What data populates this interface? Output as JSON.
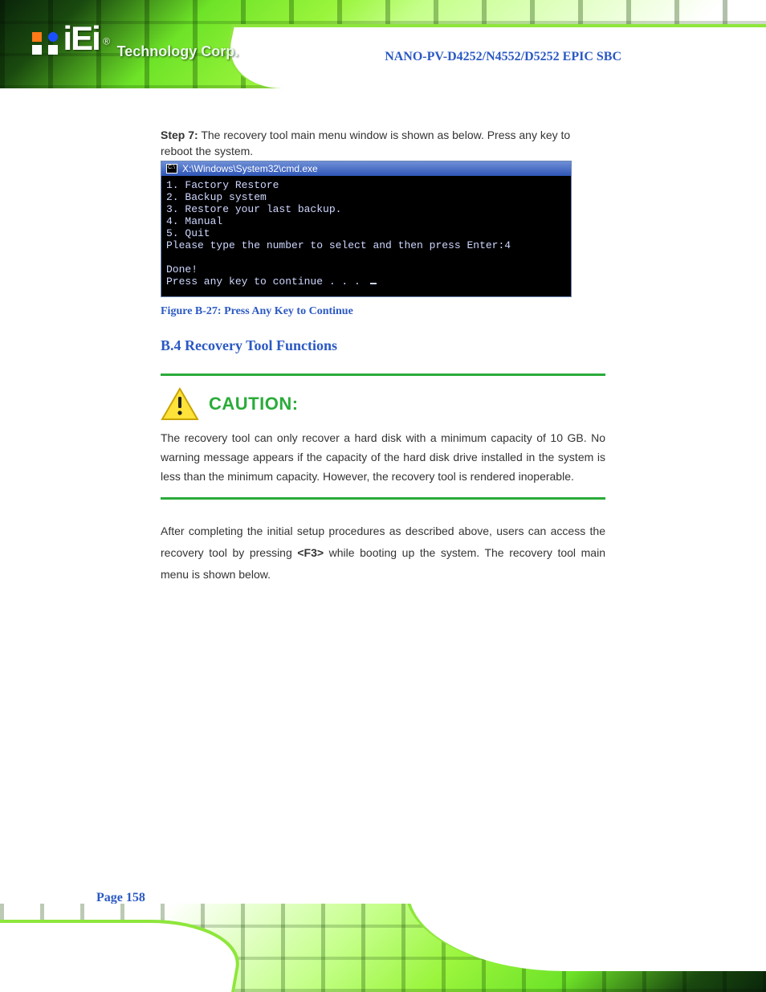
{
  "brand": {
    "logo_text": "iEi",
    "registered": "®",
    "tagline": "Technology Corp."
  },
  "document_title": "NANO-PV-D4252/N4552/D5252 EPIC SBC",
  "step7": {
    "label": "Step 7:",
    "text_a": "The recovery tool main menu window is shown as below. Press any key to",
    "text_b": "reboot the system.",
    "press_any": "Press any key to",
    "reboot": "reboot the system."
  },
  "cmd": {
    "title": "X:\\Windows\\System32\\cmd.exe",
    "lines": [
      "1. Factory Restore",
      "2. Backup system",
      "3. Restore your last backup.",
      "4. Manual",
      "5. Quit",
      "Please type the number to select and then press Enter:4",
      "",
      "Done!",
      "Press any key to continue . . . "
    ]
  },
  "figure_caption": "Figure B-27: Press Any Key to Continue",
  "section_heading": "B.4 Recovery Tool Functions",
  "caution": {
    "label": "CAUTION:",
    "text": "The recovery tool can only recover a hard disk with a minimum capacity of 10 GB. No warning message appears if the capacity of the hard disk drive installed in the system is less than the minimum capacity. However, the recovery tool is rendered inoperable."
  },
  "body_paragraph": {
    "before_code": "After completing the initial setup procedures as described above, users can access the recovery tool by pressing ",
    "key_combo": "<F3>",
    "after_code": " while booting up the system. The recovery tool main menu is shown below."
  },
  "page_number": "Page 158"
}
